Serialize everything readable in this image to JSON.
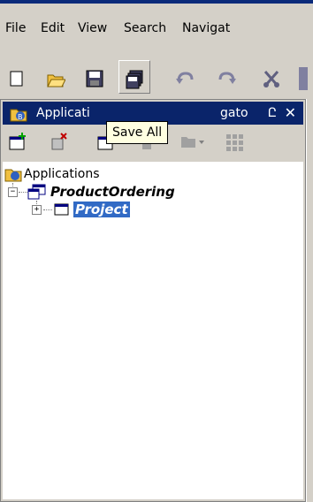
{
  "menu": {
    "file_label": "File",
    "edit_label": "Edit",
    "view_label": "View",
    "search_label": "Search",
    "navigate_label": "Navigat"
  },
  "toolbar": {
    "icons": [
      "new-icon",
      "open-icon",
      "save-icon",
      "save-all-icon",
      "undo-icon",
      "redo-icon",
      "cut-icon"
    ]
  },
  "tooltip": {
    "text": "Save All"
  },
  "panel": {
    "title": "Applicati",
    "title_tail": "gato",
    "pin_glyph": "Ը",
    "close_glyph": "✕"
  },
  "tree": {
    "root_label": "Applications",
    "app_label": "ProductOrdering",
    "project_label": "Project"
  }
}
